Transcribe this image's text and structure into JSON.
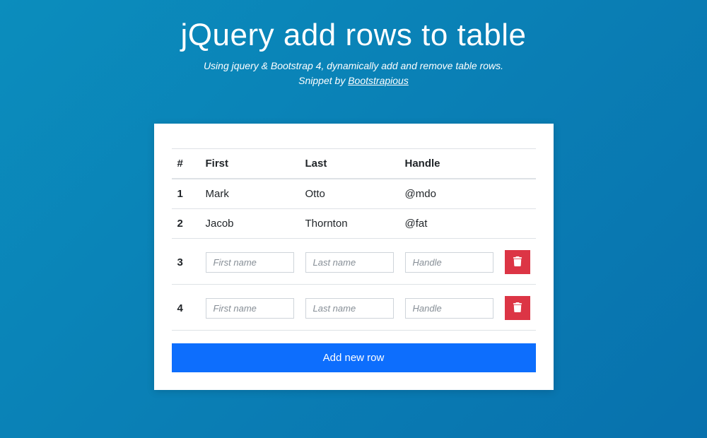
{
  "header": {
    "title": "jQuery add rows to table",
    "subtitle_line1": "Using jquery & Bootstrap 4, dynamically add and remove table rows.",
    "subtitle_prefix": "Snippet by ",
    "subtitle_link": "Bootstrapious"
  },
  "table": {
    "columns": {
      "index": "#",
      "first": "First",
      "last": "Last",
      "handle": "Handle"
    },
    "rows": [
      {
        "index": "1",
        "first": "Mark",
        "last": "Otto",
        "handle": "@mdo"
      },
      {
        "index": "2",
        "first": "Jacob",
        "last": "Thornton",
        "handle": "@fat"
      }
    ],
    "input_rows": [
      {
        "index": "3"
      },
      {
        "index": "4"
      }
    ],
    "placeholders": {
      "first": "First name",
      "last": "Last name",
      "handle": "Handle"
    }
  },
  "buttons": {
    "add": "Add new row"
  }
}
